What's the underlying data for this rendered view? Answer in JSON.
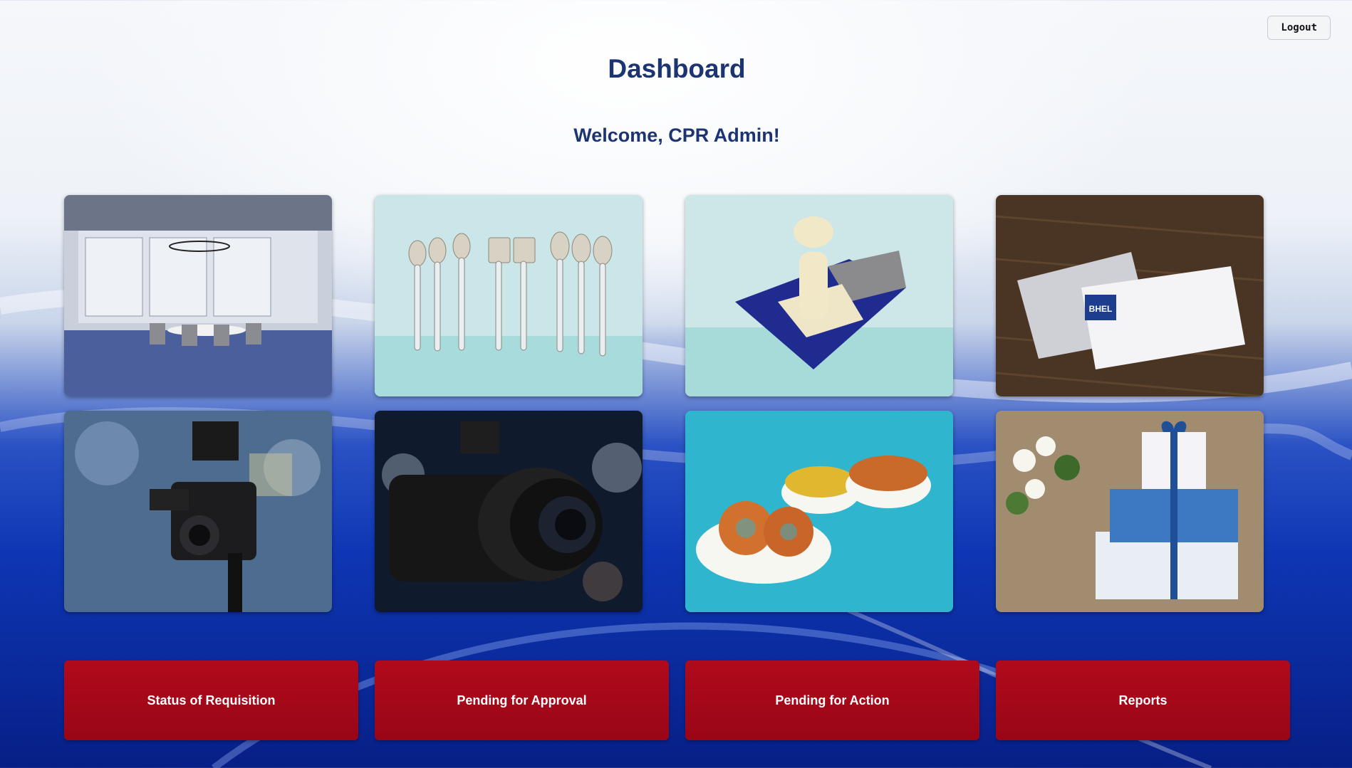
{
  "header": {
    "logout_label": "Logout",
    "title": "Dashboard",
    "welcome": "Welcome, CPR Admin!"
  },
  "tiles": [
    {
      "image": "office-interior"
    },
    {
      "image": "cutlery-set"
    },
    {
      "image": "rubber-stamp"
    },
    {
      "image": "visiting-cards",
      "logo_text": "BHEL"
    },
    {
      "image": "video-camera"
    },
    {
      "image": "dslr-camera"
    },
    {
      "image": "snacks"
    },
    {
      "image": "gift-boxes"
    }
  ],
  "actions": [
    {
      "label": "Status of Requisition"
    },
    {
      "label": "Pending for Approval"
    },
    {
      "label": "Pending for Action"
    },
    {
      "label": "Reports"
    }
  ],
  "colors": {
    "title": "#1c3572",
    "action_button": "#a5081a",
    "background_blue": "#0e36b4"
  }
}
